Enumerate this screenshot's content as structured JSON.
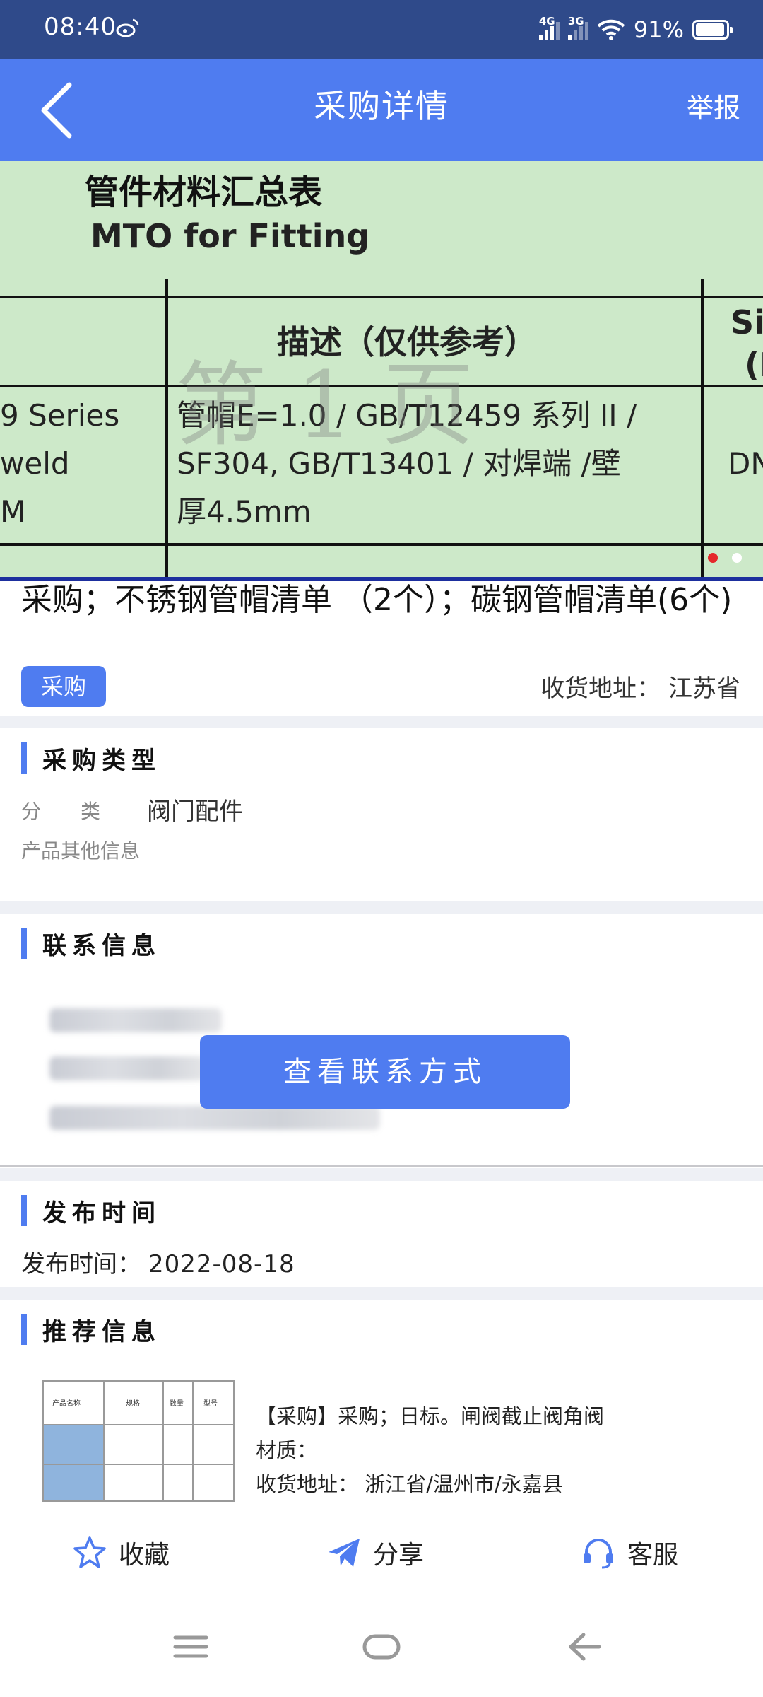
{
  "status_bar": {
    "time": "08:40",
    "network_1": "4G",
    "network_2": "3G",
    "battery_percent": "91%",
    "icons": [
      "weibo-icon",
      "signal-icon",
      "wifi-icon",
      "battery-icon"
    ]
  },
  "header": {
    "title": "采购详情",
    "report_label": "举报",
    "back_icon": "back-arrow-icon"
  },
  "carousel": {
    "doc_title": "管件材料汇总表",
    "doc_subtitle": "MTO for Fitting",
    "table": {
      "header_desc": "描述（仅供参考）",
      "header_right_1": "Si",
      "header_right_2": "(I",
      "left_lines": [
        "9 Series",
        "weld",
        "M"
      ],
      "desc_lines": [
        "管帽E=1.0 / GB/T12459 系列 II /",
        "SF304, GB/T13401 / 对焊端 /壁",
        "厚4.5mm"
      ],
      "right_cell": "DN"
    },
    "watermark": "第1页",
    "page_count": 2,
    "active_index": 0
  },
  "summary": {
    "title": "采购；不锈钢管帽清单 （2个）；碳钢管帽清单(6个)",
    "tag": "采购",
    "address_label": "收货地址：",
    "address_value": "江苏省"
  },
  "purchase_type": {
    "heading": "采购类型",
    "category_label": "分　　类",
    "category_value": "阀门配件",
    "other_label": "产品其他信息"
  },
  "contact": {
    "heading": "联系信息",
    "button_label": "查看联系方式"
  },
  "publish": {
    "heading": "发布时间",
    "label": "发布时间：",
    "value": "2022-08-18"
  },
  "recommend": {
    "heading": "推荐信息",
    "thumb_headers": [
      "产品名称",
      "规格",
      "数量",
      "型号"
    ],
    "line1": "【采购】采购；日标。闸阀截止阀角阀",
    "line2": "材质：",
    "line3": "收货地址：  浙江省/温州市/永嘉县"
  },
  "bottom_actions": {
    "favorite": "收藏",
    "share": "分享",
    "service": "客服"
  },
  "colors": {
    "status_bar": "#2f4a8a",
    "primary": "#4f7cf0",
    "carousel_bg": "#cde9c9",
    "divider": "#eef0f5"
  }
}
